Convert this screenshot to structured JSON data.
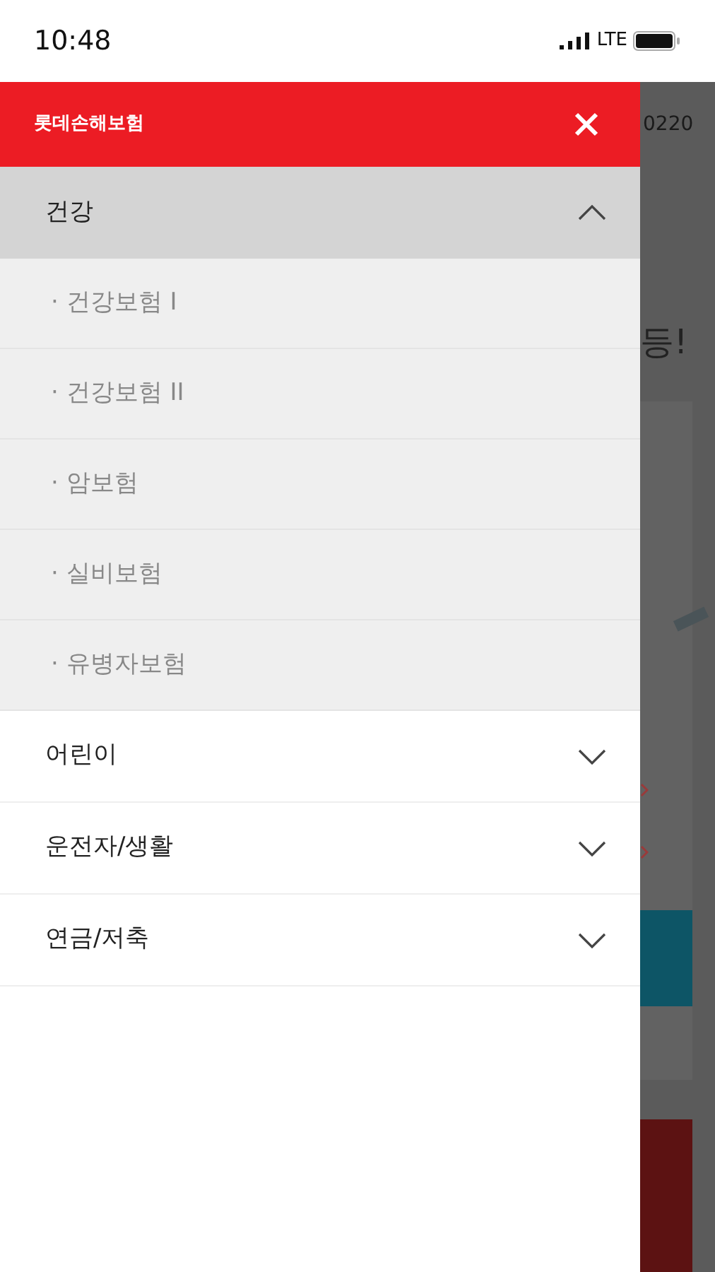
{
  "status_bar": {
    "time": "10:48",
    "network": "LTE"
  },
  "drawer": {
    "title": "롯데손해보험",
    "sections": [
      {
        "label": "건강",
        "expanded": true,
        "children": [
          {
            "label": "· 건강보험 Ⅰ"
          },
          {
            "label": "· 건강보험 II"
          },
          {
            "label": "· 암보험"
          },
          {
            "label": "· 실비보험"
          },
          {
            "label": "· 유병자보험"
          }
        ]
      },
      {
        "label": "어린이",
        "expanded": false
      },
      {
        "label": "운전자/생활",
        "expanded": false
      },
      {
        "label": "연금/저축",
        "expanded": false
      }
    ]
  },
  "background_page": {
    "header_text": "0220",
    "headline": "등!"
  }
}
